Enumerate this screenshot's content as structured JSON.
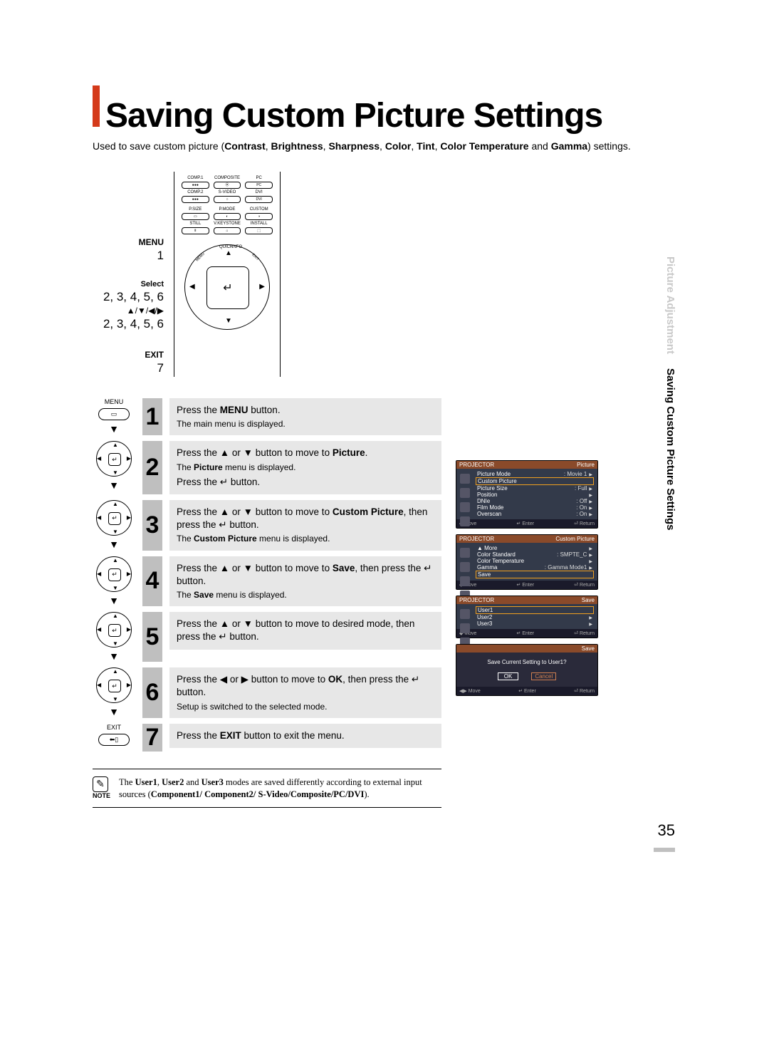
{
  "title": "Saving Custom Picture Settings",
  "subtitle_prefix": "Used to save custom picture (",
  "subtitle_bold_parts": [
    "Contrast",
    "Brightness",
    "Sharpness",
    "Color",
    "Tint",
    "Color Temperature"
  ],
  "subtitle_middle": " and ",
  "subtitle_bold_last": "Gamma",
  "subtitle_suffix": ") settings.",
  "remote_labels": {
    "menu": "MENU",
    "menu_step": "1",
    "select": "Select",
    "select_steps": "2, 3, 4, 5, 6",
    "arrows": "▲/▼/◀/▶",
    "arrows_steps": "2, 3, 4, 5, 6",
    "exit": "EXIT",
    "exit_step": "7"
  },
  "remote_top": {
    "row1": [
      "COMP.1",
      "COMPOSITE",
      "PC"
    ],
    "row2": [
      "COMP.2",
      "S-VIDEO",
      "DVI"
    ],
    "row3": [
      "P.SIZE",
      "P.MODE",
      "CUSTOM"
    ],
    "row4": [
      "STILL",
      "V.KEYSTONE",
      "INSTALL"
    ],
    "diag": {
      "quick": "QUICK",
      "info": "INFO",
      "menu": "MENU",
      "exit": "EXIT"
    }
  },
  "steps": [
    {
      "num": "1",
      "icon_type": "menu",
      "icon_label_top": "MENU",
      "text_html": "Press the <b>MENU</b> button.",
      "sub": "The main menu is displayed."
    },
    {
      "num": "2",
      "icon_type": "dpad",
      "text_html": "Press the ▲ or ▼ button to move to <b>Picture</b>.",
      "sub": "The <b>Picture</b> menu is displayed.",
      "extra_line": "Press the ↵ button."
    },
    {
      "num": "3",
      "icon_type": "dpad",
      "text_html": "Press the ▲ or ▼ button to move to <b>Custom Picture</b>, then press the ↵ button.",
      "sub": "The <b>Custom Picture</b> menu is displayed."
    },
    {
      "num": "4",
      "icon_type": "dpad",
      "text_html": "Press the ▲ or ▼ button to move to <b>Save</b>, then press the ↵ button.",
      "sub": "The <b>Save</b> menu is displayed."
    },
    {
      "num": "5",
      "icon_type": "dpad",
      "text_html": "Press the ▲ or ▼ button to move to desired mode, then press the ↵ button.",
      "sub": ""
    },
    {
      "num": "6",
      "icon_type": "dpad",
      "text_html": "Press the ◀ or ▶ button to move to <b>OK</b>, then press the ↵ button.",
      "sub": "Setup is switched to the selected mode."
    },
    {
      "num": "7",
      "icon_type": "exit",
      "icon_label_top": "EXIT",
      "text_html": "Press the <b>EXIT</b> button to exit the menu.",
      "sub": ""
    }
  ],
  "note": {
    "label": "NOTE",
    "text": "The <b>User1</b>, <b>User2</b> and <b>User3</b> modes are saved differently according to external input sources (<b>Component1/ Component2/ S-Video/Composite/PC/DVI</b>)."
  },
  "sidetab": {
    "faded": "Picture Adjustment",
    "normal": "Saving Custom Picture Settings"
  },
  "osd": {
    "picture": {
      "projector_label": "PROJECTOR",
      "tab": "Picture",
      "rows": [
        {
          "k": "Picture Mode",
          "v": ": Movie 1"
        },
        {
          "k": "Custom Picture",
          "v": "",
          "hl": true
        },
        {
          "k": "Picture Size",
          "v": ": Full"
        },
        {
          "k": "Position",
          "v": ""
        },
        {
          "k": "DNIe",
          "v": ": Off"
        },
        {
          "k": "Film Mode",
          "v": ": On"
        },
        {
          "k": "Overscan",
          "v": ": On"
        }
      ],
      "foot": [
        "◆ Move",
        "↵ Enter",
        "⏎ Return"
      ]
    },
    "custom": {
      "projector_label": "PROJECTOR",
      "tab": "Custom Picture",
      "rows": [
        {
          "k": "▲ More",
          "v": ""
        },
        {
          "k": "Color Standard",
          "v": ": SMPTE_C"
        },
        {
          "k": "Color Temperature",
          "v": ""
        },
        {
          "k": "Gamma",
          "v": ": Gamma Mode1"
        },
        {
          "k": "Save",
          "v": "",
          "hl": true
        }
      ],
      "foot": [
        "◆ Move",
        "↵ Enter",
        "⏎ Return"
      ]
    },
    "save": {
      "projector_label": "PROJECTOR",
      "tab": "Save",
      "rows": [
        {
          "k": "User1",
          "v": "",
          "hl": true
        },
        {
          "k": "User2",
          "v": ""
        },
        {
          "k": "User3",
          "v": ""
        }
      ],
      "foot": [
        "◆ Move",
        "↵ Enter",
        "⏎ Return"
      ]
    },
    "confirm": {
      "tab": "Save",
      "msg": "Save Current Setting to User1?",
      "ok": "OK",
      "cancel": "Cancel",
      "foot": [
        "◀▶ Move",
        "↵ Enter",
        "⏎ Return"
      ]
    }
  },
  "page_number": "35"
}
